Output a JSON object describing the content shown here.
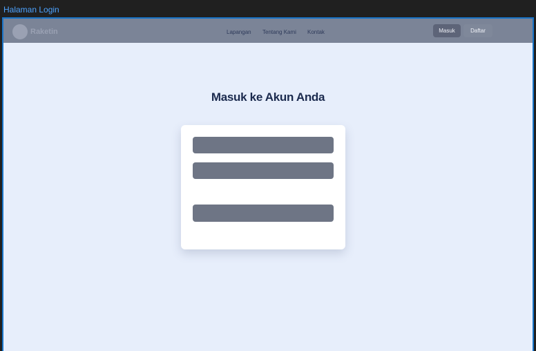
{
  "window": {
    "title": "Halaman Login"
  },
  "navbar": {
    "brand": "Raketin",
    "links": [
      "Lapangan",
      "Tentang Kami",
      "Kontak"
    ],
    "login_button": "Masuk",
    "register_button": "Daftar"
  },
  "main": {
    "heading": "Masuk ke Akun Anda"
  },
  "colors": {
    "navbar_bg": "#7b8497",
    "page_bg": "#e7eefb",
    "heading": "#1b2a4e",
    "frame_border": "#1874c8",
    "placeholder_block": "#6e7585"
  }
}
